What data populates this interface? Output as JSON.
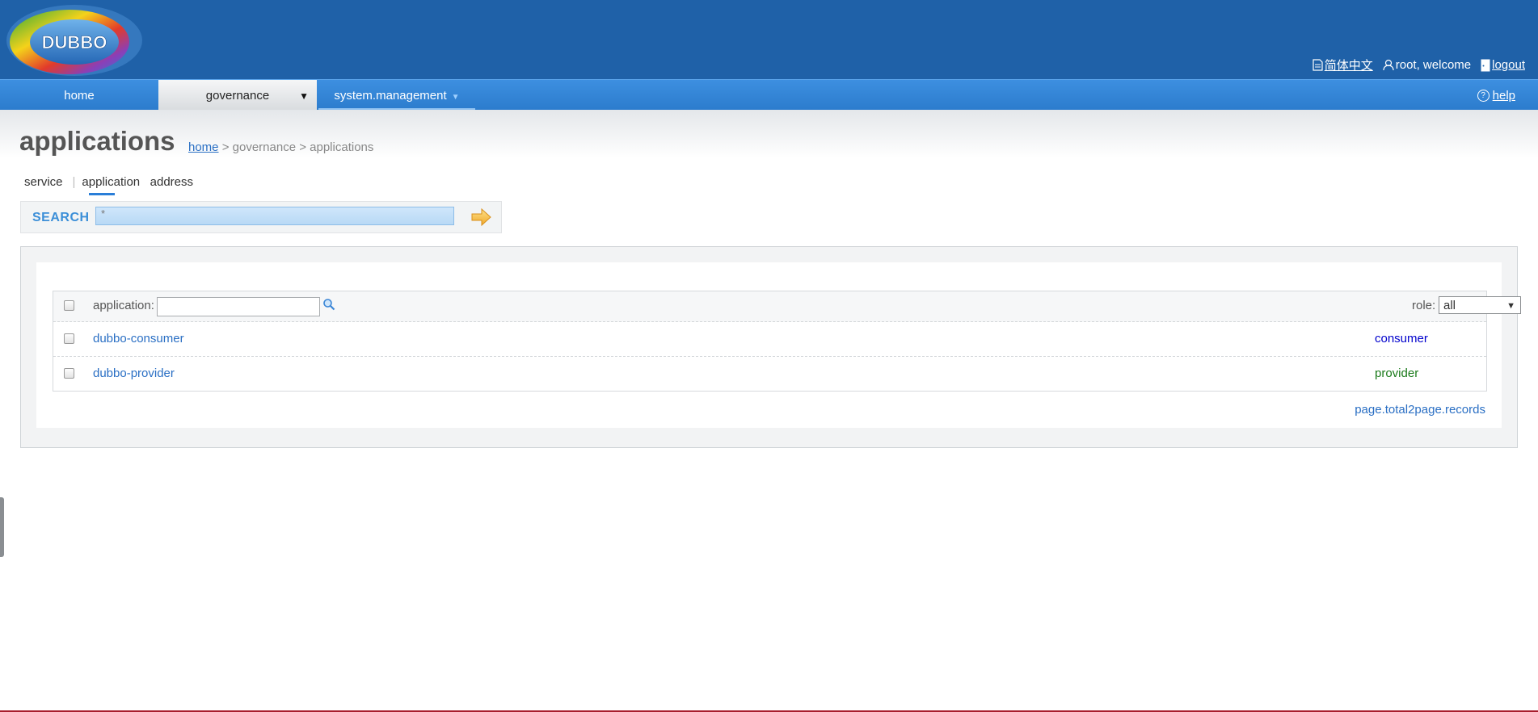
{
  "brand": {
    "logo_text": "DUBBO"
  },
  "header": {
    "language_label": "简体中文",
    "user_label": "root, welcome",
    "logout_label": "logout"
  },
  "nav": {
    "items": [
      {
        "label": "home"
      },
      {
        "label": "governance"
      },
      {
        "label": "system.management"
      }
    ],
    "help_label": "help"
  },
  "page": {
    "title": "applications",
    "breadcrumb": {
      "home": "home",
      "sep1": " > ",
      "section": "governance",
      "sep2": " > ",
      "current": "applications"
    }
  },
  "subtabs": {
    "items": [
      {
        "label": "service"
      },
      {
        "label": "application"
      },
      {
        "label": "address"
      }
    ],
    "separator": "|"
  },
  "search": {
    "label": "SEARCH",
    "value": "*"
  },
  "table": {
    "filter_label": "application:",
    "filter_value": "",
    "role_label": "role:",
    "role_selected": "all",
    "rows": [
      {
        "application": "dubbo-consumer",
        "role": "consumer"
      },
      {
        "application": "dubbo-provider",
        "role": "provider"
      }
    ]
  },
  "pager": {
    "text": "page.total2page.records"
  },
  "colors": {
    "header_bg": "#1f61a8",
    "nav_bg": "#3d8fe0",
    "link": "#2a6fc4",
    "consumer": "#0000cc",
    "provider": "#1a7a1a"
  }
}
